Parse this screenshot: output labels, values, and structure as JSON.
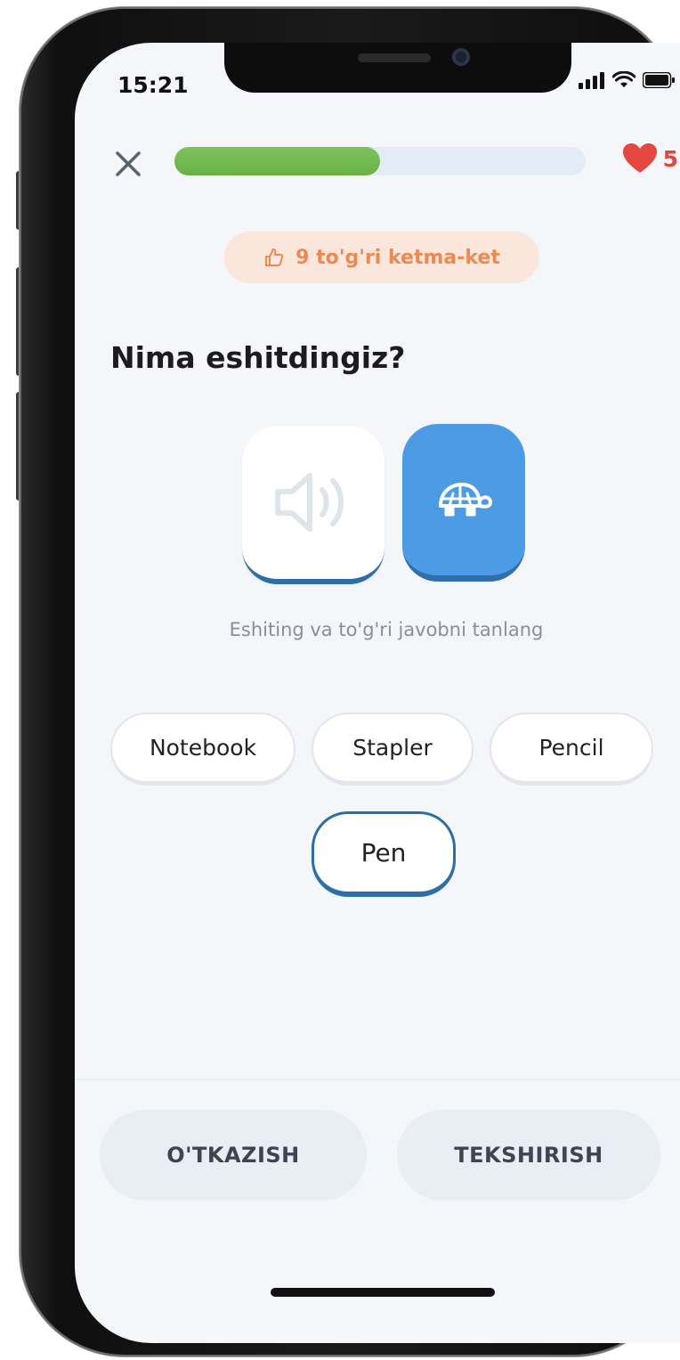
{
  "status_bar": {
    "time": "15:21",
    "signal_icon": "signal-bars-icon",
    "wifi_icon": "wifi-icon",
    "battery_icon": "battery-icon"
  },
  "header": {
    "close_icon": "close-icon",
    "progress_fraction": 0.5,
    "heart_icon": "heart-icon",
    "hearts_count": "5"
  },
  "streak": {
    "icon": "thumbs-up-icon",
    "text": "9 to'g'ri ketma-ket"
  },
  "question": {
    "title": "Nima eshitdingiz?"
  },
  "audio": {
    "play_icon": "speaker-icon",
    "slow_icon": "turtle-icon"
  },
  "instruction": "Eshiting va to'g'ri javobni tanlang",
  "options": [
    {
      "label": "Notebook",
      "selected": false
    },
    {
      "label": "Stapler",
      "selected": false
    },
    {
      "label": "Pencil",
      "selected": false
    },
    {
      "label": "Pen",
      "selected": true
    }
  ],
  "actions": {
    "skip_label": "O'TKAZISH",
    "check_label": "TEKSHIRISH"
  },
  "colors": {
    "progress": "#6cb34a",
    "accent_blue": "#4b9ce5",
    "heart": "#e4473f",
    "streak_text": "#ec8a55"
  }
}
